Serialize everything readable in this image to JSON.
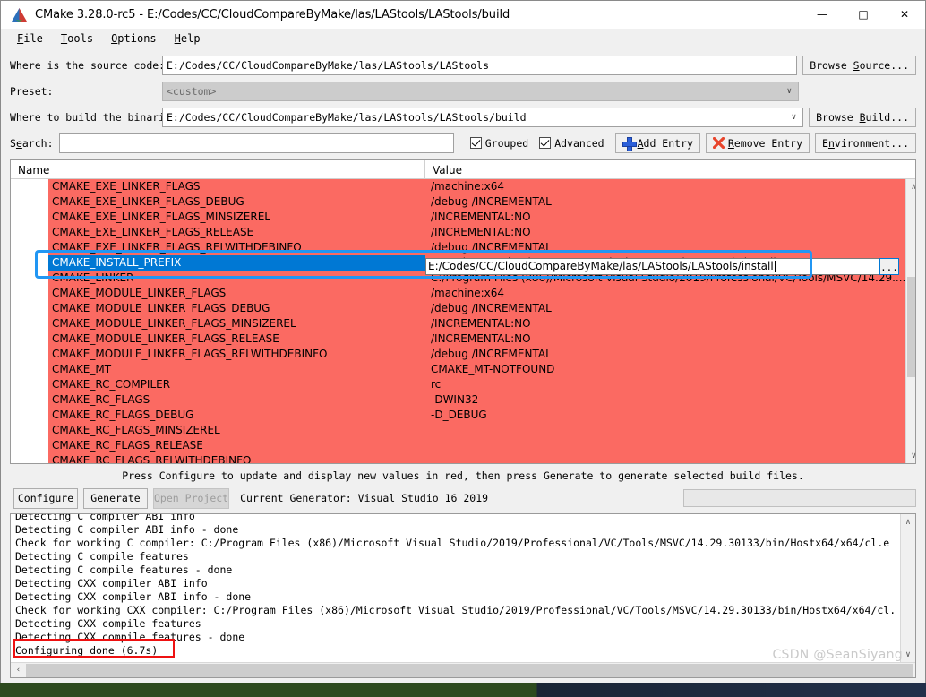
{
  "window": {
    "title": "CMake 3.28.0-rc5 - E:/Codes/CC/CloudCompareByMake/las/LAStools/LAStools/build",
    "logo_icon": "cmake-triangle-logo",
    "minimize_icon": "minimize-icon",
    "maximize_icon": "maximize-icon",
    "close_icon": "close-icon",
    "minimize_glyph": "—",
    "maximize_glyph": "□",
    "close_glyph": "✕"
  },
  "menubar": {
    "items": [
      {
        "label": "File",
        "accel": "F"
      },
      {
        "label": "Tools",
        "accel": "T"
      },
      {
        "label": "Options",
        "accel": "O"
      },
      {
        "label": "Help",
        "accel": "H"
      }
    ]
  },
  "form": {
    "source_label": "Where is the source code:",
    "source_value": "E:/Codes/CC/CloudCompareByMake/las/LAStools/LAStools",
    "browse_source_label": "Browse Source...",
    "browse_source_accel": "S",
    "preset_label": "Preset:",
    "preset_value": "<custom>",
    "build_label": "Where to build the binaries:",
    "build_value": "E:/Codes/CC/CloudCompareByMake/las/LAStools/LAStools/build",
    "browse_build_label": "Browse Build...",
    "browse_build_accel": "B",
    "search_label": "Search:",
    "search_value": "",
    "search_placeholder": "",
    "grouped_label": "Grouped",
    "grouped_checked": true,
    "advanced_label": "Advanced",
    "advanced_checked": true,
    "add_entry_label": "Add Entry",
    "add_entry_icon": "plus-icon",
    "remove_entry_label": "Remove Entry",
    "remove_entry_icon": "red-x-icon",
    "environment_label": "Environment...",
    "combo_arrow_glyph": "∨"
  },
  "table": {
    "col_name": "Name",
    "col_value": "Value",
    "rows": [
      {
        "name": "CMAKE_EXE_LINKER_FLAGS",
        "value": "/machine:x64",
        "state": "modified"
      },
      {
        "name": "CMAKE_EXE_LINKER_FLAGS_DEBUG",
        "value": "/debug /INCREMENTAL",
        "state": "modified"
      },
      {
        "name": "CMAKE_EXE_LINKER_FLAGS_MINSIZEREL",
        "value": "/INCREMENTAL:NO",
        "state": "modified"
      },
      {
        "name": "CMAKE_EXE_LINKER_FLAGS_RELEASE",
        "value": "/INCREMENTAL:NO",
        "state": "modified"
      },
      {
        "name": "CMAKE_EXE_LINKER_FLAGS_RELWITHDEBINFO",
        "value": "/debug /INCREMENTAL",
        "state": "modified"
      },
      {
        "name": "CMAKE_INSTALL_PREFIX",
        "value": "E:/Codes/CC/CloudCompareByMake/las/LAStools/LAStools/install",
        "state": "selected-editing"
      },
      {
        "name": "CMAKE_LINKER",
        "value": "C:/Program Files (x86)/Microsoft Visual Studio/2019/Professional/VC/Tools/MSVC/14.29....",
        "state": "modified"
      },
      {
        "name": "CMAKE_MODULE_LINKER_FLAGS",
        "value": "/machine:x64",
        "state": "modified"
      },
      {
        "name": "CMAKE_MODULE_LINKER_FLAGS_DEBUG",
        "value": "/debug /INCREMENTAL",
        "state": "modified"
      },
      {
        "name": "CMAKE_MODULE_LINKER_FLAGS_MINSIZEREL",
        "value": "/INCREMENTAL:NO",
        "state": "modified"
      },
      {
        "name": "CMAKE_MODULE_LINKER_FLAGS_RELEASE",
        "value": "/INCREMENTAL:NO",
        "state": "modified"
      },
      {
        "name": "CMAKE_MODULE_LINKER_FLAGS_RELWITHDEBINFO",
        "value": "/debug /INCREMENTAL",
        "state": "modified"
      },
      {
        "name": "CMAKE_MT",
        "value": "CMAKE_MT-NOTFOUND",
        "state": "modified"
      },
      {
        "name": "CMAKE_RC_COMPILER",
        "value": "rc",
        "state": "modified"
      },
      {
        "name": "CMAKE_RC_FLAGS",
        "value": "-DWIN32",
        "state": "modified"
      },
      {
        "name": "CMAKE_RC_FLAGS_DEBUG",
        "value": "-D_DEBUG",
        "state": "modified"
      },
      {
        "name": "CMAKE_RC_FLAGS_MINSIZEREL",
        "value": "",
        "state": "modified"
      },
      {
        "name": "CMAKE_RC_FLAGS_RELEASE",
        "value": "",
        "state": "modified"
      },
      {
        "name": "CMAKE_RC_FLAGS_RELWITHDEBINFO",
        "value": "",
        "state": "modified"
      }
    ],
    "editor": {
      "value": "E:/Codes/CC/CloudCompareByMake/las/LAStools/LAStools/install",
      "browse_label": "...",
      "browse_icon": "ellipsis-browse-icon"
    },
    "scroll_up_glyph": "∧",
    "scroll_down_glyph": "∨"
  },
  "footer": {
    "hint": "Press Configure to update and display new values in red, then press Generate to generate selected build files.",
    "configure_label": "Configure",
    "configure_accel": "C",
    "generate_label": "Generate",
    "generate_accel": "G",
    "open_project_label": "Open Project",
    "open_project_accel": "P",
    "open_project_disabled": true,
    "generator_text": "Current Generator: Visual Studio 16 2019"
  },
  "console": {
    "lines": [
      "Detecting C compiler ABI info",
      "Detecting C compiler ABI info - done",
      "Check for working C compiler: C:/Program Files (x86)/Microsoft Visual Studio/2019/Professional/VC/Tools/MSVC/14.29.30133/bin/Hostx64/x64/cl.e",
      "Detecting C compile features",
      "Detecting C compile features - done",
      "Detecting CXX compiler ABI info",
      "Detecting CXX compiler ABI info - done",
      "Check for working CXX compiler: C:/Program Files (x86)/Microsoft Visual Studio/2019/Professional/VC/Tools/MSVC/14.29.30133/bin/Hostx64/x64/cl.",
      "Detecting CXX compile features",
      "Detecting CXX compile features - done",
      "Configuring done (6.7s)"
    ],
    "highlighted_line_index": 10,
    "scroll_up_glyph": "∧",
    "scroll_down_glyph": "∨",
    "hscroll_left_glyph": "‹"
  },
  "watermark": "CSDN @SeanSiyang",
  "colors": {
    "modified_row": "#fb6a62",
    "selection": "#0078d4",
    "annotation_blue": "#2196f3",
    "annotation_red": "#ee1111",
    "window_bg": "#f0f0f0"
  }
}
